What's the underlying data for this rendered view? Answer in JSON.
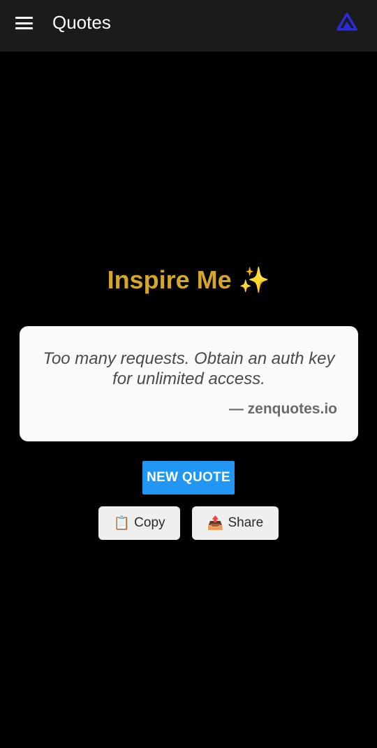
{
  "appbar": {
    "title": "Quotes",
    "menu_icon": "hamburger-menu-icon",
    "logo_icon": "app-logo-icon",
    "logo_color": "#2b2bd9"
  },
  "main": {
    "heading": "Inspire Me ✨",
    "heading_color": "#d4a72c",
    "quote": {
      "text": "Too many requests. Obtain an auth key for unlimited access.",
      "author": "— zenquotes.io"
    },
    "new_quote_label": "NEW QUOTE",
    "new_quote_color": "#2196f3",
    "copy": {
      "icon": "📋",
      "label": "Copy"
    },
    "share": {
      "icon": "📤",
      "label": "Share"
    }
  }
}
